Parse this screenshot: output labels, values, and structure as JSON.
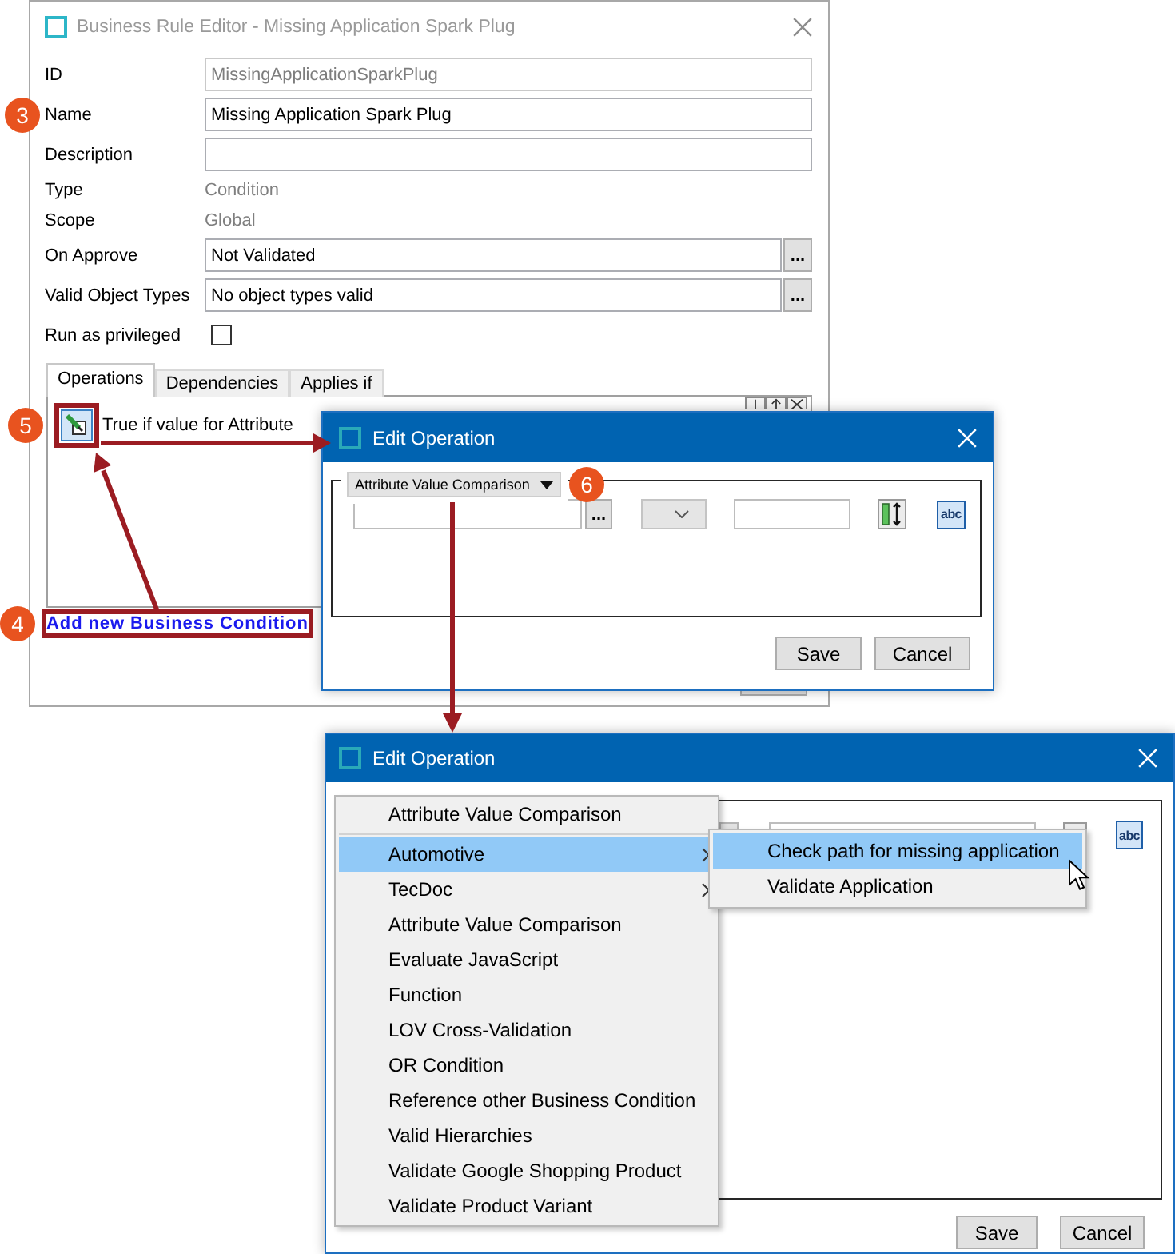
{
  "business_rule_editor": {
    "title": "Business Rule Editor - Missing Application Spark Plug",
    "fields": [
      {
        "kind": "input",
        "label": "ID",
        "value": "MissingApplicationSparkPlug",
        "disabled": true
      },
      {
        "kind": "input",
        "label": "Name",
        "value": "Missing Application Spark Plug",
        "disabled": false,
        "marker": "3"
      },
      {
        "kind": "input",
        "label": "Description",
        "disabled": false
      },
      {
        "kind": "text",
        "label": "Type",
        "value": "Condition"
      },
      {
        "kind": "text",
        "label": "Scope",
        "value": "Global"
      },
      {
        "kind": "picker",
        "label": "On Approve",
        "value": "Not Validated",
        "button": "...",
        "disabled": false
      },
      {
        "kind": "picker",
        "label": "Valid Object Types",
        "value": "No object types valid",
        "button": "...",
        "disabled": false
      },
      {
        "kind": "checkbox",
        "label": "Run as privileged",
        "checked": false
      }
    ],
    "tabs": [
      {
        "label": "Operations",
        "selected": true
      },
      {
        "label": "Dependencies",
        "selected": false
      },
      {
        "label": "Applies if",
        "selected": false
      }
    ],
    "operations": [
      {
        "text": "True if value for Attribute",
        "marker": "5"
      }
    ],
    "add_link": {
      "label": "Add new Business Condition",
      "marker": "4"
    }
  },
  "edit_operation_dialog": {
    "title": "Edit Operation",
    "operation_type": "Attribute Value Comparison",
    "operation_type_marker": "6",
    "browse_button": "...",
    "text_mode_button": "abc",
    "buttons": [
      "Save",
      "Cancel"
    ]
  },
  "edit_operation_menu_dialog": {
    "title": "Edit Operation",
    "text_mode_button": "abc",
    "menu": [
      {
        "kind": "item",
        "label": "Attribute Value Comparison",
        "has_submenu": false,
        "selected": false
      },
      {
        "kind": "separator"
      },
      {
        "kind": "item",
        "label": "Automotive",
        "has_submenu": true,
        "selected": true
      },
      {
        "kind": "item",
        "label": "TecDoc",
        "has_submenu": true,
        "selected": false
      },
      {
        "kind": "item",
        "label": "Attribute Value Comparison",
        "has_submenu": false,
        "selected": false
      },
      {
        "kind": "item",
        "label": "Evaluate JavaScript",
        "has_submenu": false,
        "selected": false
      },
      {
        "kind": "item",
        "label": "Function",
        "has_submenu": false,
        "selected": false
      },
      {
        "kind": "item",
        "label": "LOV Cross-Validation",
        "has_submenu": false,
        "selected": false
      },
      {
        "kind": "item",
        "label": "OR Condition",
        "has_submenu": false,
        "selected": false
      },
      {
        "kind": "item",
        "label": "Reference other Business Condition",
        "has_submenu": false,
        "selected": false
      },
      {
        "kind": "item",
        "label": "Valid Hierarchies",
        "has_submenu": false,
        "selected": false
      },
      {
        "kind": "item",
        "label": "Validate Google Shopping Product",
        "has_submenu": false,
        "selected": false
      },
      {
        "kind": "item",
        "label": "Validate Product Variant",
        "has_submenu": false,
        "selected": false
      }
    ],
    "submenu": [
      {
        "label": "Check path for missing application",
        "selected": true
      },
      {
        "label": "Validate Application",
        "selected": false
      }
    ],
    "buttons": [
      "Save",
      "Cancel"
    ]
  }
}
